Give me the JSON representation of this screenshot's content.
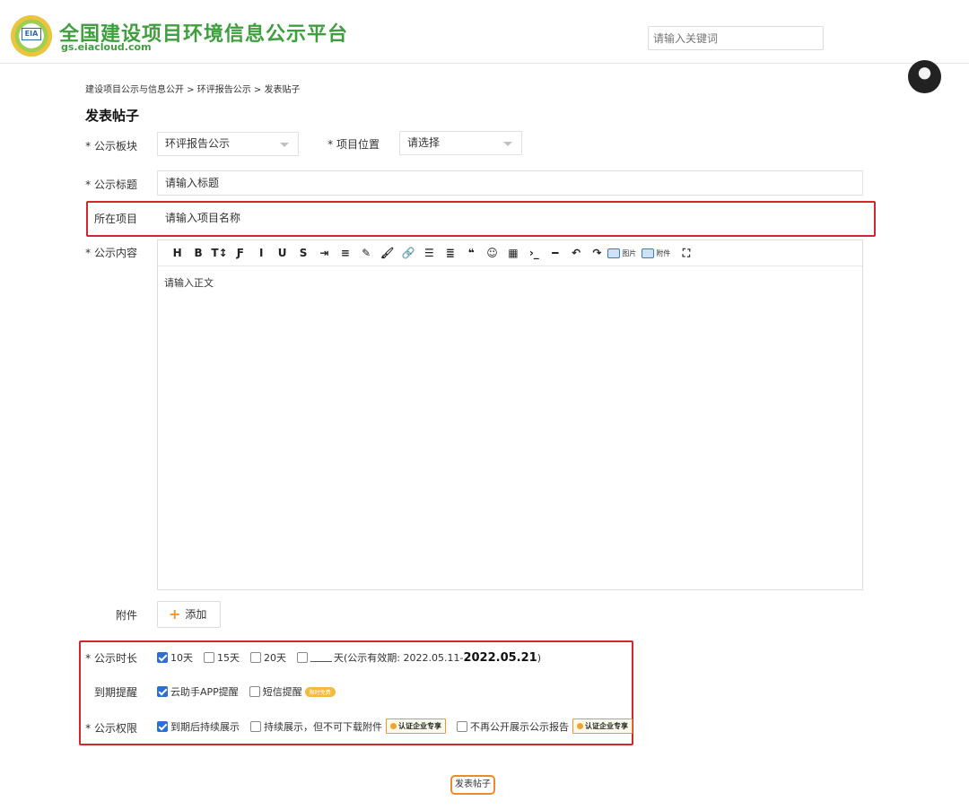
{
  "header": {
    "logo_text": "EIA",
    "site_title": "全国建设项目环境信息公示平台",
    "site_url": "gs.eiacloud.com",
    "search_placeholder": "请输入关键词"
  },
  "breadcrumb": "建设项目公示与信息公开 > 环评报告公示 > 发表贴子",
  "page_title": "发表帖子",
  "form": {
    "section_label": "公示板块",
    "section_value": "环评报告公示",
    "location_label": "项目位置",
    "location_value": "请选择",
    "title_label": "公示标题",
    "title_placeholder": "请输入标题",
    "project_label": "所在项目",
    "project_placeholder": "请输入项目名称",
    "content_label": "公示内容",
    "content_placeholder": "请输入正文",
    "attachment_label": "附件",
    "add_label": "添加",
    "duration_label": "公示时长",
    "duration_options": [
      "10天",
      "15天",
      "20天"
    ],
    "duration_custom_suffix": "天(公示有效期: 2022.05.11-",
    "duration_end_date": "2022.05.21",
    "duration_close": ")",
    "expire_label": "到期提醒",
    "expire_app": "云助手APP提醒",
    "expire_sms": "短信提醒",
    "expire_sms_pill": "限时免费",
    "permission_label": "公示权限",
    "perm_continue": "到期后持续展示",
    "perm_no_download": "持续展示，但不可下载附件",
    "perm_no_public": "不再公开展示公示报告",
    "badge_text": "认证企业专享"
  },
  "toolbar": [
    "H",
    "B",
    "T↕",
    "Ƒ",
    "I",
    "U",
    "S",
    "⇥",
    "≡",
    "✎",
    "🖌",
    "🔗",
    "☰",
    "≣",
    "❝",
    "☺",
    "▦",
    "›_",
    "━",
    "↶",
    "↷"
  ],
  "toolbar_image": "图片",
  "toolbar_attach": "附件",
  "submit_label": "发表帖子"
}
